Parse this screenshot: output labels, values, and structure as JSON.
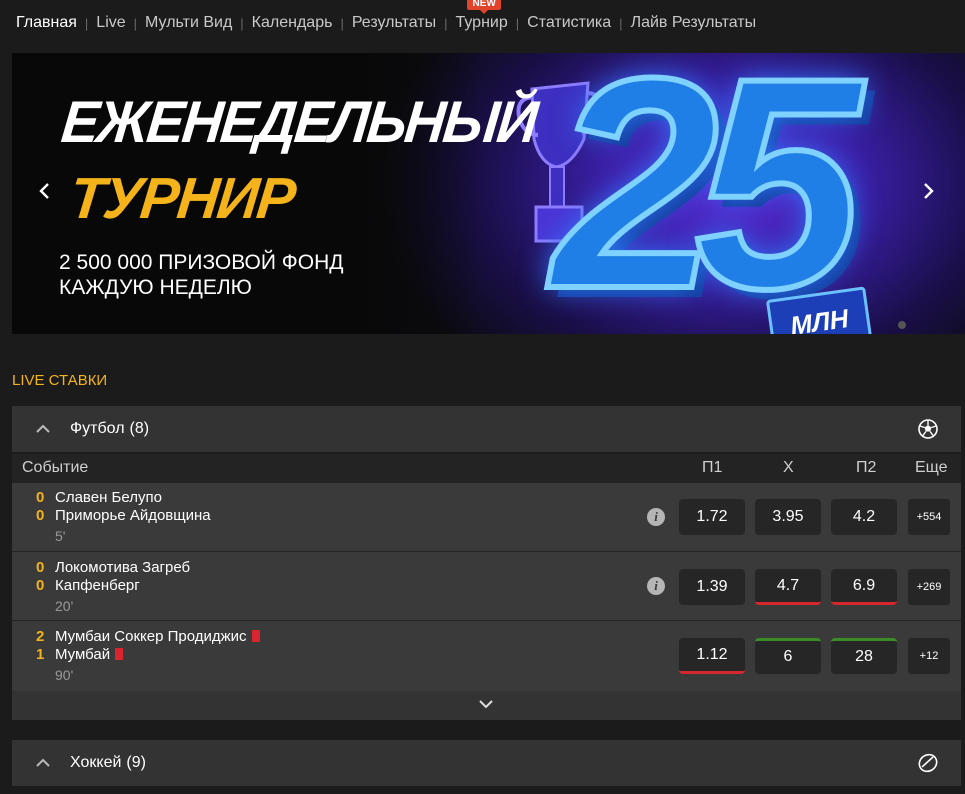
{
  "nav": {
    "items": [
      "Главная",
      "Live",
      "Мульти Вид",
      "Календарь",
      "Результаты",
      "Турнир",
      "Статистика",
      "Лайв Результаты"
    ],
    "new_badge": "NEW"
  },
  "banner": {
    "title_line1": "ЕЖЕНЕДЕЛЬНЫЙ",
    "title_line2": "ТУРНИР",
    "subtitle": "2 500 000 ПРИЗОВОЙ ФОНД КАЖДУЮ НЕДЕЛЮ",
    "big_number": "25",
    "unit": "МЛН",
    "prev_icon": "chevron-left-icon",
    "next_icon": "chevron-right-icon"
  },
  "live_title": "LIVE СТАВКИ",
  "football": {
    "name": "Футбол",
    "count": "(8)",
    "icon": "soccer-ball-icon",
    "columns": {
      "event": "Событие",
      "p1": "П1",
      "x": "X",
      "p2": "П2",
      "more": "Еще"
    },
    "matches": [
      {
        "score1": "0",
        "team1": "Славен Белупо",
        "score2": "0",
        "team2": "Приморье Айдовщина",
        "time": "5'",
        "p1": "1.72",
        "x": "3.95",
        "p2": "4.2",
        "more": "+554"
      },
      {
        "score1": "0",
        "team1": "Локомотива Загреб",
        "score2": "0",
        "team2": "Капфенберг",
        "time": "20'",
        "p1": "1.39",
        "x": "4.7",
        "p2": "6.9",
        "more": "+269"
      },
      {
        "score1": "2",
        "team1": "Мумбаи Соккер Продиджис",
        "score2": "1",
        "team2": "Мумбай",
        "time": "90'",
        "p1": "1.12",
        "x": "6",
        "p2": "28",
        "more": "+12"
      }
    ]
  },
  "hockey": {
    "name": "Хоккей",
    "count": "(9)",
    "icon": "hockey-puck-icon"
  },
  "colors": {
    "accent": "#f4b31a",
    "down": "#d6262e",
    "up": "#3b8c26"
  }
}
